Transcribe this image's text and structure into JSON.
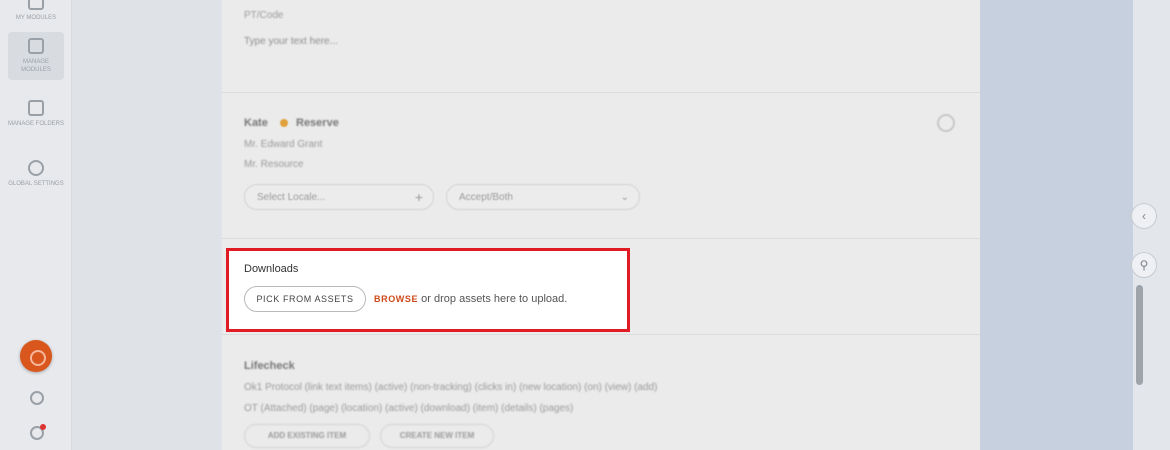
{
  "rail": {
    "items": [
      {
        "label": "MY MODULES"
      },
      {
        "label": "MANAGE MODULES"
      },
      {
        "label": "MANAGE FOLDERS"
      },
      {
        "label": "GLOBAL SETTINGS"
      }
    ]
  },
  "background": {
    "top_label": "PT/Code",
    "top_placeholder": "Type your text here...",
    "row_name": "Kate",
    "row_status": "Reserve",
    "row_line1": "Mr. Edward Grant",
    "row_line2": "Mr. Resource",
    "select_left": "Select Locale...",
    "select_right": "Accept/Both",
    "section_title": "Lifecheck",
    "section_line1": "Ok1 Protocol (link text items) (active) (non-tracking) (clicks in) (new location) (on) (view) (add)",
    "section_line2": "OT (Attached) (page) (location) (active) (download) (item) (details) (pages)",
    "btn1": "ADD EXISTING ITEM",
    "btn2": "CREATE NEW ITEM"
  },
  "downloads": {
    "title": "Downloads",
    "pick_label": "PICK FROM ASSETS",
    "browse_label": "BROWSE",
    "drop_text": " or drop assets here to upload."
  },
  "colors": {
    "highlight_border": "#e01b24",
    "accent_orange": "#cf4a1a",
    "fab": "#d9561d"
  }
}
